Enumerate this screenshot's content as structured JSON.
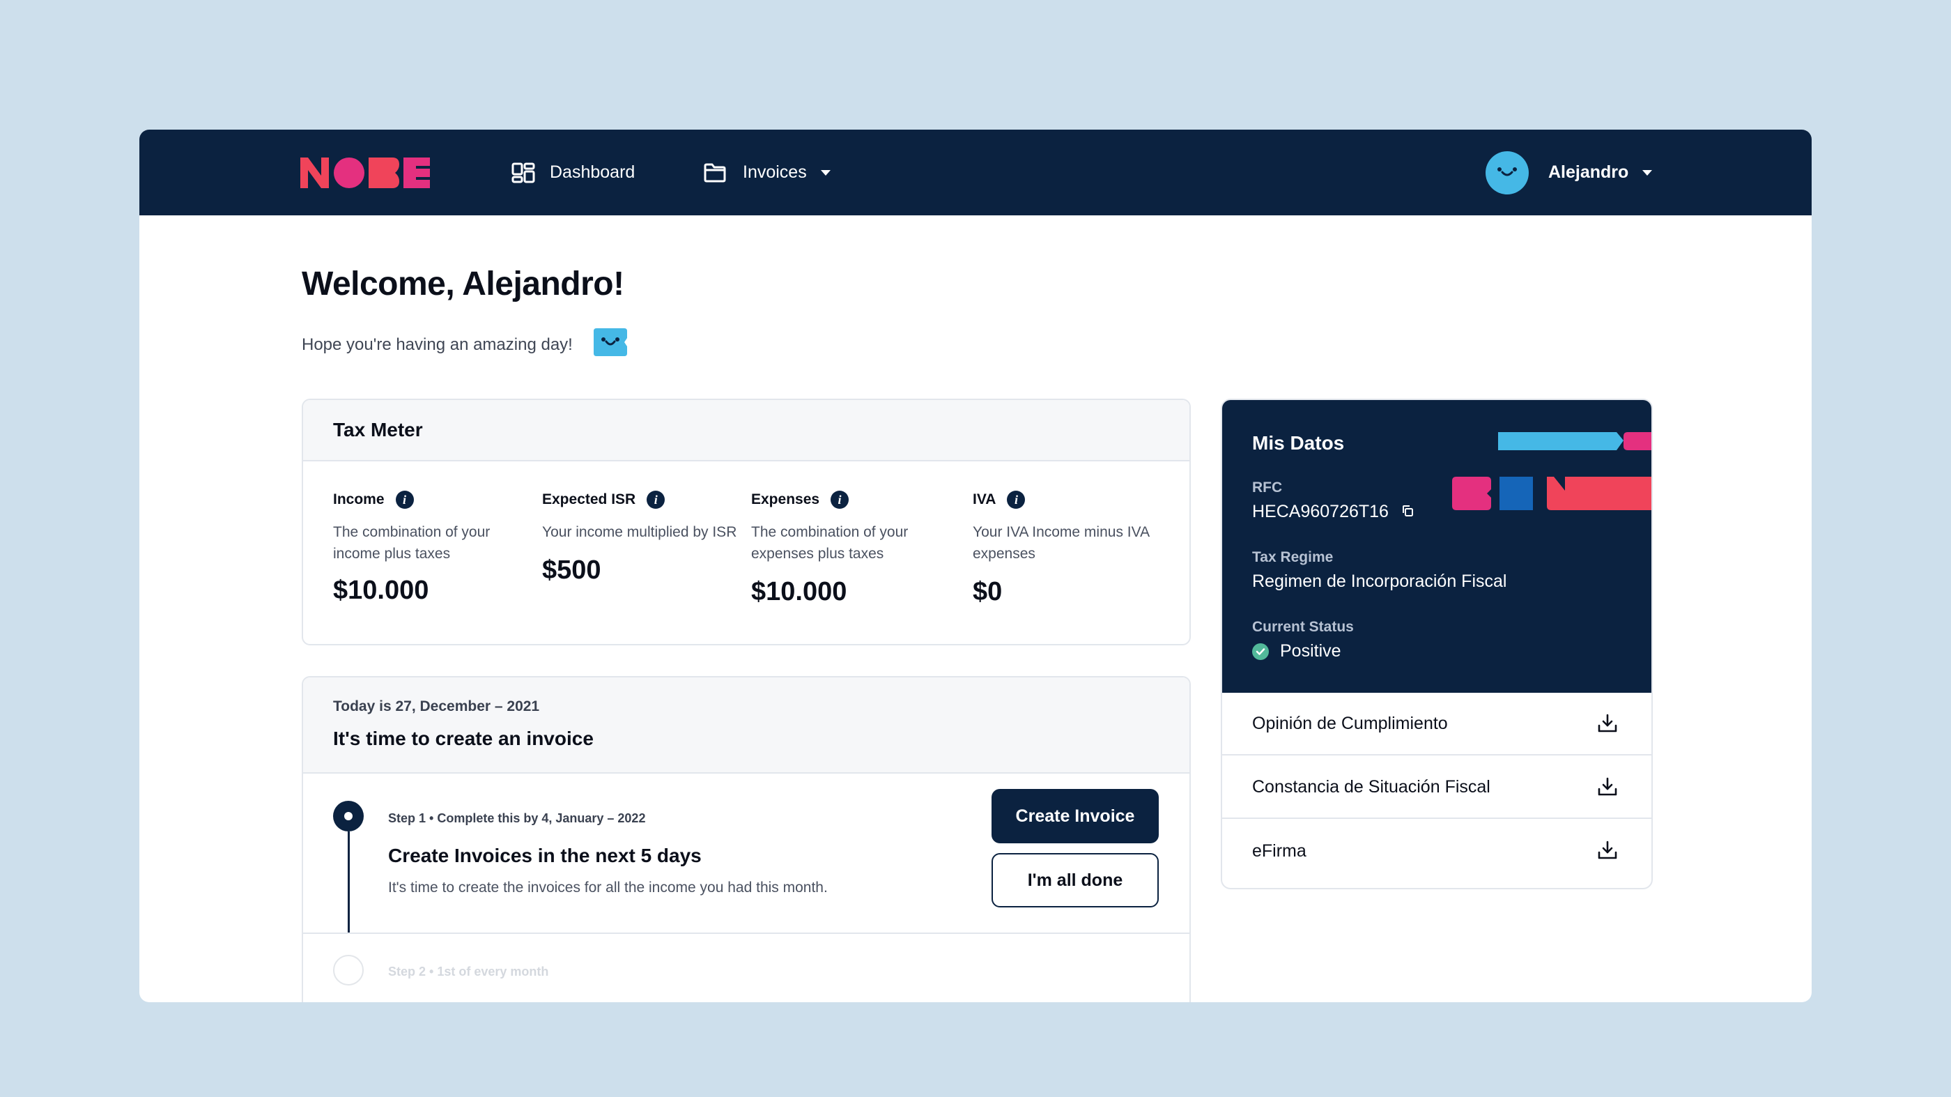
{
  "nav": {
    "logo_text": "NOBE",
    "dashboard_label": "Dashboard",
    "invoices_label": "Invoices",
    "user_name": "Alejandro",
    "colors": {
      "background": "#0b2240",
      "logo_red": "#f0445a",
      "logo_pink": "#e4307f",
      "avatar": "#45b8e6"
    }
  },
  "header": {
    "title": "Welcome, Alejandro!",
    "subtitle": "Hope you're having an amazing day!"
  },
  "tax_meter": {
    "title": "Tax Meter",
    "metrics": [
      {
        "label": "Income",
        "description": "The combination of your income plus taxes",
        "value": "$10.000"
      },
      {
        "label": "Expected ISR",
        "description": "Your income multiplied by ISR",
        "value": "$500"
      },
      {
        "label": "Expenses",
        "description": "The combination of your expenses plus taxes",
        "value": "$10.000"
      },
      {
        "label": "IVA",
        "description": "Your IVA Income minus IVA expenses",
        "value": "$0"
      }
    ]
  },
  "invoice_steps": {
    "date": "Today is 27, December – 2021",
    "title": "It's time to create an invoice",
    "step1": {
      "meta": "Step 1 • Complete this by 4, January – 2022",
      "title": "Create Invoices in the next 5 days",
      "description": "It's time to create the invoices for all the income you had this month.",
      "primary_button": "Create Invoice",
      "secondary_button": "I'm all done"
    },
    "step2": {
      "meta": "Step 2 • 1st of every month"
    }
  },
  "mis_datos": {
    "title": "Mis Datos",
    "rfc_label": "RFC",
    "rfc_value": "HECA960726T16",
    "regime_label": "Tax Regime",
    "regime_value": "Regimen de Incorporación Fiscal",
    "status_label": "Current Status",
    "status_value": "Positive",
    "status_color": "#52b99a",
    "downloads": [
      {
        "label": "Opinión de Cumplimiento"
      },
      {
        "label": "Constancia de Situación Fiscal"
      },
      {
        "label": "eFirma"
      }
    ]
  }
}
